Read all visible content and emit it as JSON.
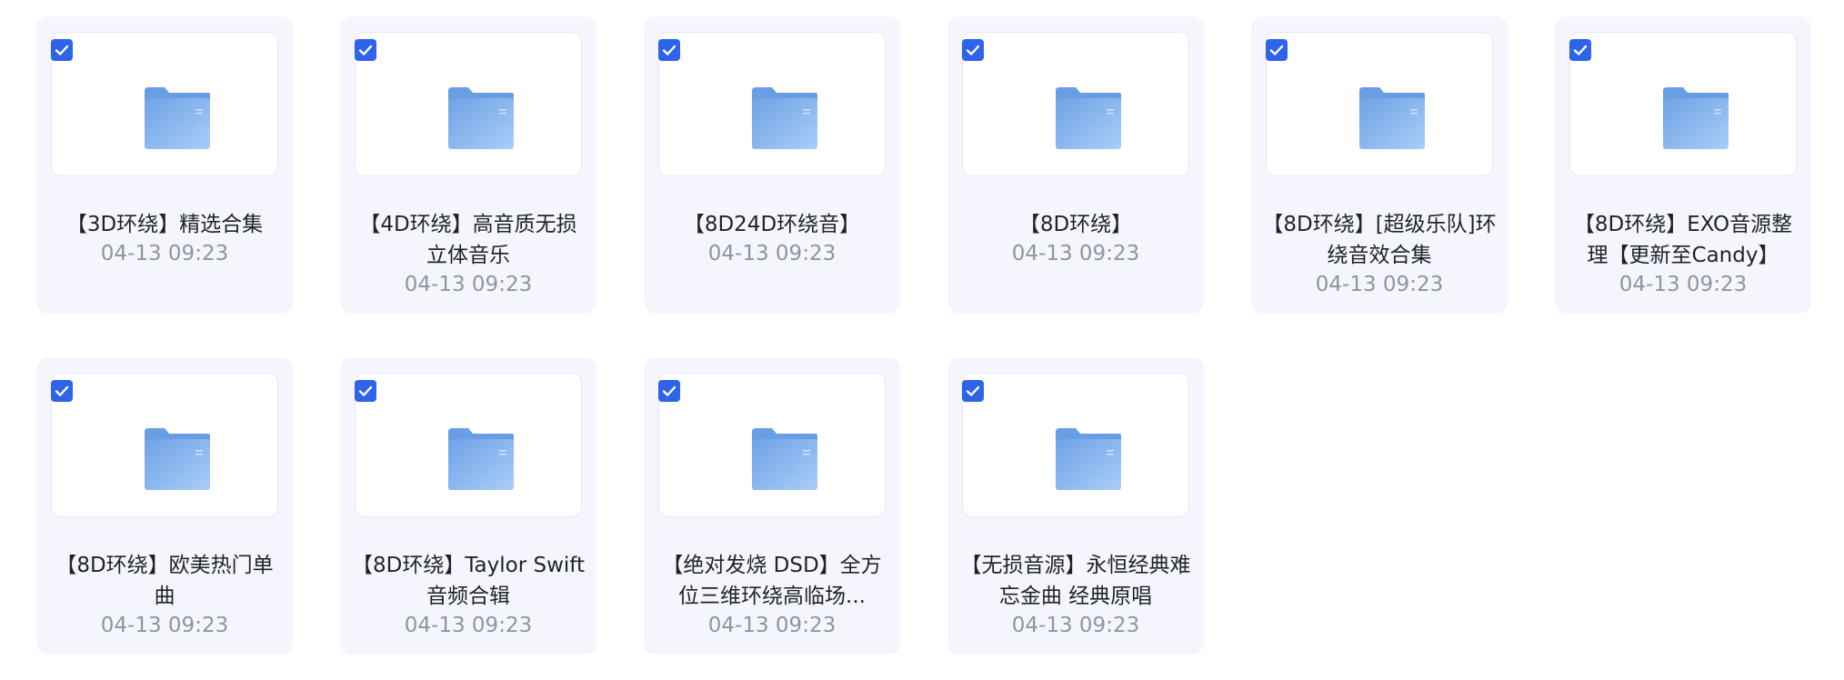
{
  "colors": {
    "card_bg": "#f5f6fd",
    "checkbox": "#2f63ea",
    "folder": "#7fb0ee",
    "name_text": "#1f2329",
    "date_text": "#8f959e"
  },
  "icons": {
    "checkbox": "checkbox-checked-icon",
    "folder": "folder-icon"
  },
  "files": [
    {
      "name": "【3D环绕】精选合集",
      "date": "04-13 09:23",
      "checked": true,
      "lines": 1
    },
    {
      "name": "【4D环绕】高音质无损立体音乐",
      "date": "04-13 09:23",
      "checked": true,
      "lines": 2
    },
    {
      "name": "【8D24D环绕音】",
      "date": "04-13 09:23",
      "checked": true,
      "lines": 1
    },
    {
      "name": "【8D环绕】",
      "date": "04-13 09:23",
      "checked": true,
      "lines": 1
    },
    {
      "name": "【8D环绕】[超级乐队]环绕音效合集",
      "date": "04-13 09:23",
      "checked": true,
      "lines": 2
    },
    {
      "name": "【8D环绕】EXO音源整理【更新至Candy】",
      "date": "04-13 09:23",
      "checked": true,
      "lines": 2
    },
    {
      "name": "【8D环绕】欧美热门单曲",
      "date": "04-13 09:23",
      "checked": true,
      "lines": 2
    },
    {
      "name": "【8D环绕】Taylor Swift 音频合辑",
      "date": "04-13 09:23",
      "checked": true,
      "lines": 2
    },
    {
      "name": "【绝对发烧 DSD】全方位三维环绕高临场...",
      "date": "04-13 09:23",
      "checked": true,
      "lines": 2
    },
    {
      "name": "【无损音源】永恒经典难忘金曲 经典原唱",
      "date": "04-13 09:23",
      "checked": true,
      "lines": 2
    }
  ]
}
